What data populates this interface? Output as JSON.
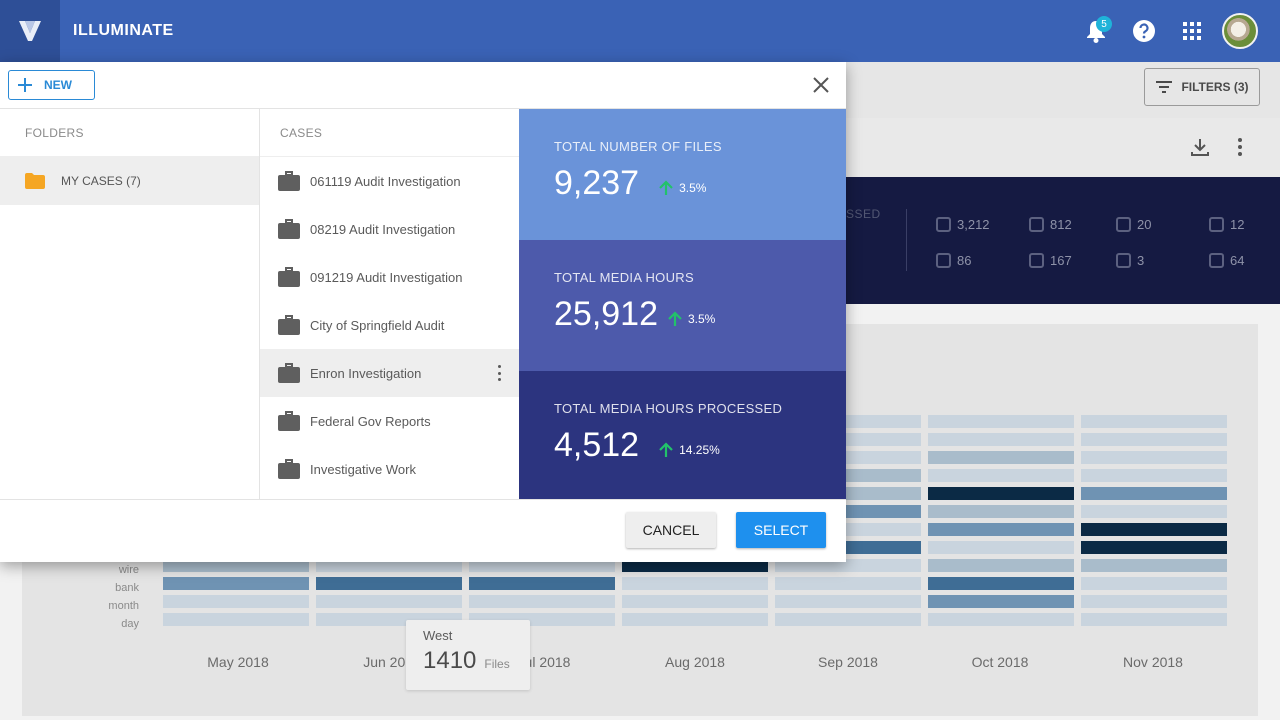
{
  "app": {
    "title": "ILLUMINATE",
    "notification_count": "5"
  },
  "icons": {
    "logo": "logo-icon",
    "bell": "bell-icon",
    "help": "help-icon",
    "apps": "apps-grid-icon",
    "close": "close-icon",
    "plus": "plus-icon",
    "folder": "folder-icon",
    "briefcase": "briefcase-icon",
    "arrow_up": "arrow-up-icon",
    "filter": "filter-icon",
    "download": "download-icon",
    "kebab": "kebab-icon"
  },
  "colors": {
    "appbar": "#3a62b5",
    "accent": "#1e90ee",
    "stat1": "#6a93d9",
    "stat2": "#4d5aab",
    "stat3": "#2c347f",
    "arrow_up": "#22c26a",
    "folder": "#f5a623"
  },
  "background": {
    "filters_label": "FILTERS (3)",
    "processed_fragment": "SSED",
    "stats": [
      {
        "icon": "audio-icon",
        "value": "3,212"
      },
      {
        "icon": "face-icon",
        "value": "812"
      },
      {
        "icon": "translate-icon",
        "value": "20"
      },
      {
        "icon": "scan-icon",
        "value": "12"
      },
      {
        "icon": "badge-icon",
        "value": "86"
      },
      {
        "icon": "people-icon",
        "value": "167"
      },
      {
        "icon": "sentiment-icon",
        "value": "3"
      },
      {
        "icon": "redact-icon",
        "value": "64"
      }
    ],
    "chart": {
      "row_labels": [
        "wire",
        "bank",
        "month",
        "day"
      ],
      "months": [
        "May 2018",
        "Jun 2018",
        "Jul 2018",
        "Aug 2018",
        "Sep 2018",
        "Oct 2018",
        "Nov 2018"
      ],
      "tooltip": {
        "region": "West",
        "value": "1410",
        "unit": "Files"
      }
    }
  },
  "dialog": {
    "new_label": "NEW",
    "folders_header": "FOLDERS",
    "cases_header": "CASES",
    "folders": [
      {
        "label": "MY CASES (7)"
      }
    ],
    "cases": [
      {
        "label": "061119 Audit Investigation"
      },
      {
        "label": "08219 Audit Investigation"
      },
      {
        "label": "091219 Audit Investigation"
      },
      {
        "label": "City of Springfield Audit"
      },
      {
        "label": "Enron Investigation"
      },
      {
        "label": "Federal Gov Reports"
      },
      {
        "label": "Investigative Work"
      }
    ],
    "selected_case_index": 4,
    "stats": [
      {
        "title": "TOTAL NUMBER OF FILES",
        "value": "9,237",
        "delta": "3.5%"
      },
      {
        "title": "TOTAL MEDIA HOURS",
        "value": "25,912",
        "delta": "3.5%"
      },
      {
        "title": "TOTAL MEDIA HOURS PROCESSED",
        "value": "4,512",
        "delta": "14.25%"
      }
    ],
    "cancel_label": "CANCEL",
    "select_label": "SELECT"
  }
}
